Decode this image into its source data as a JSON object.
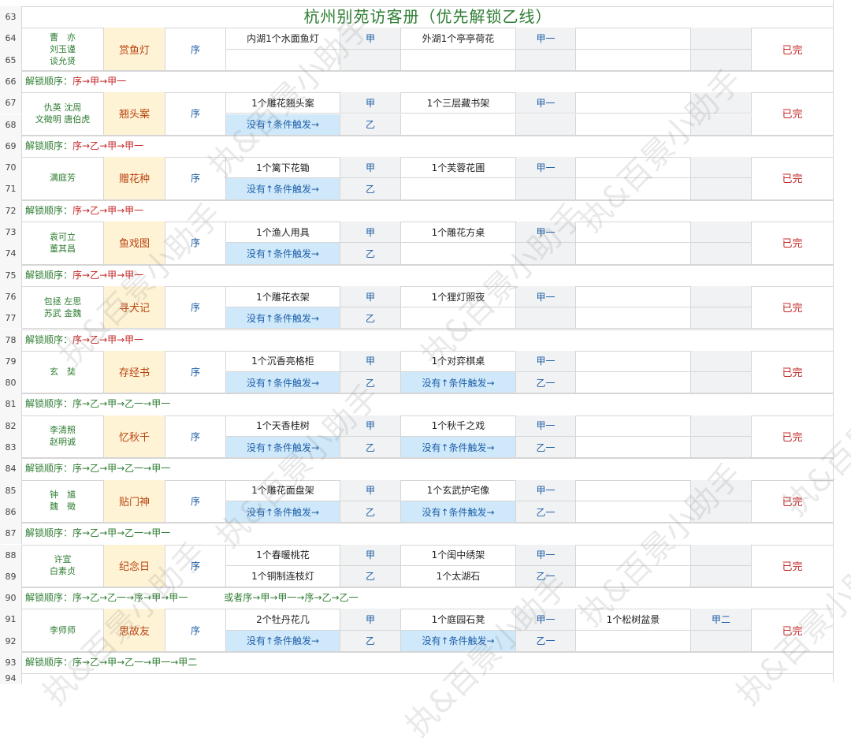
{
  "title": "杭州别苑访客册（优先解锁乙线）",
  "title_row": "63",
  "done_label": "已完",
  "seq_label": "序",
  "trigger_label": "没有↑条件触发→",
  "watermark": "执&百景小助手",
  "groups": [
    {
      "rows": [
        "64",
        "65"
      ],
      "unlock_row": "66",
      "names": [
        "曹　亦",
        "刘玉谨",
        "谈允贤"
      ],
      "event": "赏鱼灯",
      "lines": [
        {
          "item1": "内湖1个水面鱼灯",
          "g1": "甲",
          "item2": "外湖1个亭亭荷花",
          "g2": "甲一",
          "item3": "",
          "g3": ""
        }
      ],
      "unlock": {
        "prefix": "解锁顺序：",
        "hot": "序→甲→甲一",
        "rest": ""
      }
    },
    {
      "rows": [
        "67",
        "68"
      ],
      "unlock_row": "69",
      "names": [
        "仇英 沈周",
        "文徵明 唐伯虎"
      ],
      "event": "翘头案",
      "lines": [
        {
          "item1": "1个雕花翘头案",
          "g1": "甲",
          "item2": "1个三层藏书架",
          "g2": "甲一",
          "item3": "",
          "g3": ""
        },
        {
          "item1": "TRIGGER",
          "g1": "乙",
          "item2": "",
          "g2": "",
          "item3": "",
          "g3": ""
        }
      ],
      "unlock": {
        "prefix": "解锁顺序：",
        "hot": "序→乙→甲→甲一",
        "rest": ""
      }
    },
    {
      "rows": [
        "70",
        "71"
      ],
      "unlock_row": "72",
      "names": [
        "满庭芳"
      ],
      "event": "赠花种",
      "lines": [
        {
          "item1": "1个篱下花锄",
          "g1": "甲",
          "item2": "1个芙蓉花圃",
          "g2": "甲一",
          "item3": "",
          "g3": ""
        },
        {
          "item1": "TRIGGER",
          "g1": "乙",
          "item2": "",
          "g2": "",
          "item3": "",
          "g3": ""
        }
      ],
      "unlock": {
        "prefix": "解锁顺序：",
        "hot": "序→乙→甲→甲一",
        "rest": ""
      }
    },
    {
      "rows": [
        "73",
        "74"
      ],
      "unlock_row": "75",
      "names": [
        "袁可立",
        "董其昌"
      ],
      "event": "鱼戏图",
      "lines": [
        {
          "item1": "1个渔人用具",
          "g1": "甲",
          "item2": "1个雕花方桌",
          "g2": "甲一",
          "item3": "",
          "g3": ""
        },
        {
          "item1": "TRIGGER",
          "g1": "乙",
          "item2": "",
          "g2": "",
          "item3": "",
          "g3": ""
        }
      ],
      "unlock": {
        "prefix": "解锁顺序：",
        "hot": "序→乙→甲→甲一",
        "rest": ""
      }
    },
    {
      "rows": [
        "76",
        "77"
      ],
      "unlock_row": "78",
      "names": [
        "包拯 左思",
        "苏武 金魏"
      ],
      "event": "寻犬记",
      "lines": [
        {
          "item1": "1个雕花衣架",
          "g1": "甲",
          "item2": "1个狸灯照夜",
          "g2": "甲一",
          "item3": "",
          "g3": ""
        },
        {
          "item1": "TRIGGER",
          "g1": "乙",
          "item2": "",
          "g2": "",
          "item3": "",
          "g3": ""
        }
      ],
      "unlock": {
        "prefix": "解锁顺序：",
        "hot": "序→乙→甲→甲一",
        "rest": ""
      }
    },
    {
      "rows": [
        "79",
        "80"
      ],
      "unlock_row": "81",
      "names": [
        "玄　奘"
      ],
      "event": "存经书",
      "lines": [
        {
          "item1": "1个沉香亮格柜",
          "g1": "甲",
          "item2": "1个对弈棋桌",
          "g2": "甲一",
          "item3": "",
          "g3": ""
        },
        {
          "item1": "TRIGGER",
          "g1": "乙",
          "item2": "TRIGGER",
          "g2": "乙一",
          "item3": "",
          "g3": ""
        }
      ],
      "unlock": {
        "prefix": "解锁顺序：",
        "hot": "",
        "rest": "序→乙→甲→乙一→甲一"
      }
    },
    {
      "rows": [
        "82",
        "83"
      ],
      "unlock_row": "84",
      "names": [
        "李清照",
        "赵明诚"
      ],
      "event": "忆秋千",
      "lines": [
        {
          "item1": "1个天香桂树",
          "g1": "甲",
          "item2": "1个秋千之戏",
          "g2": "甲一",
          "item3": "",
          "g3": ""
        },
        {
          "item1": "TRIGGER",
          "g1": "乙",
          "item2": "TRIGGER",
          "g2": "乙一",
          "item3": "",
          "g3": ""
        }
      ],
      "unlock": {
        "prefix": "解锁顺序：",
        "hot": "",
        "rest": "序→乙→甲→乙一→甲一"
      }
    },
    {
      "rows": [
        "85",
        "86"
      ],
      "unlock_row": "87",
      "names": [
        "钟　馗",
        "魏　徵"
      ],
      "event": "贴门神",
      "lines": [
        {
          "item1": "1个雕花面盘架",
          "g1": "甲",
          "item2": "1个玄武护宅像",
          "g2": "甲一",
          "item3": "",
          "g3": ""
        },
        {
          "item1": "TRIGGER",
          "g1": "乙",
          "item2": "TRIGGER",
          "g2": "乙一",
          "item3": "",
          "g3": ""
        }
      ],
      "unlock": {
        "prefix": "解锁顺序：",
        "hot": "",
        "rest": "序→乙→甲→乙一→甲一"
      }
    },
    {
      "rows": [
        "88",
        "89"
      ],
      "unlock_row": "90",
      "names": [
        "许宣",
        "白素贞"
      ],
      "event": "纪念日",
      "lines": [
        {
          "item1": "1个春暖桃花",
          "g1": "甲",
          "item2": "1个闺中绣架",
          "g2": "甲一",
          "item3": "",
          "g3": ""
        },
        {
          "item1": "1个铜制连枝灯",
          "g1": "乙",
          "item2": "1个太湖石",
          "g2": "乙一",
          "item3": "",
          "g3": ""
        }
      ],
      "unlock": {
        "prefix": "解锁顺序：",
        "hot": "",
        "rest": "序→乙→乙一→序→甲→甲一",
        "alt": "或者序→甲→甲一→序→乙→乙一"
      }
    },
    {
      "rows": [
        "91",
        "92"
      ],
      "unlock_row": "93",
      "names": [
        "李师师"
      ],
      "event": "思故友",
      "lines": [
        {
          "item1": "2个牡丹花几",
          "g1": "甲",
          "item2": "1个庭园石凳",
          "g2": "甲一",
          "item3": "1个松树盆景",
          "g3": "甲二"
        },
        {
          "item1": "TRIGGER",
          "g1": "乙",
          "item2": "TRIGGER",
          "g2": "乙一",
          "item3": "",
          "g3": ""
        }
      ],
      "unlock": {
        "prefix": "解锁顺序：",
        "hot": "",
        "rest": "序→乙→甲→乙一→甲一→甲二"
      }
    }
  ],
  "last_row": "94"
}
